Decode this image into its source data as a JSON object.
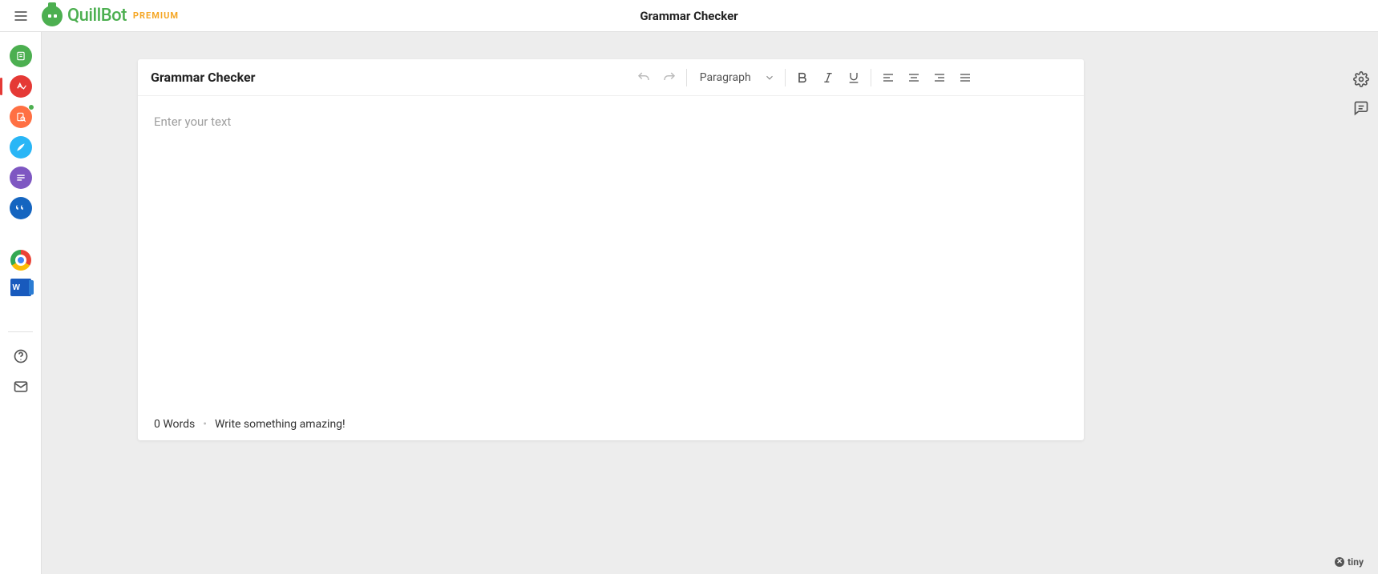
{
  "header": {
    "brand": "QuillBot",
    "premium": "PREMIUM",
    "title": "Grammar Checker"
  },
  "left_rail": {
    "items": [
      {
        "name": "paraphraser",
        "color": "green"
      },
      {
        "name": "grammar-checker",
        "color": "red",
        "active": true
      },
      {
        "name": "plagiarism-checker",
        "color": "orange",
        "badge": true
      },
      {
        "name": "co-writer",
        "color": "blue"
      },
      {
        "name": "summarizer",
        "color": "purple"
      },
      {
        "name": "citation-generator",
        "color": "indigo"
      }
    ],
    "extensions": {
      "chrome": "Chrome Extension",
      "word": "W"
    },
    "help_label": "Help",
    "contact_label": "Contact"
  },
  "editor": {
    "title": "Grammar Checker",
    "format_select": "Paragraph",
    "placeholder": "Enter your text",
    "word_count_label": "0 Words",
    "footer_tip": "Write something amazing!"
  },
  "right_rail": {
    "settings": "Settings",
    "feedback": "Feedback"
  },
  "footer": {
    "tiny": "tiny"
  }
}
